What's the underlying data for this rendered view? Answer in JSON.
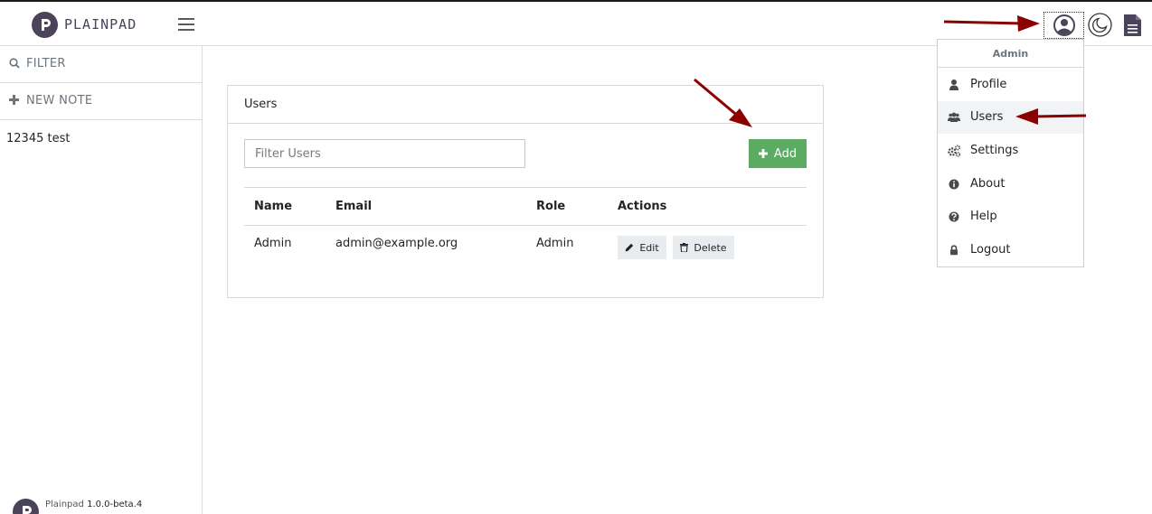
{
  "app": {
    "brand": "PLAINPAD",
    "logo_icon": "plainpad-logo-icon"
  },
  "topbar": {
    "user_icon": "user-circle-icon",
    "theme_icon": "moon-icon",
    "docs_icon": "document-icon"
  },
  "sidebar": {
    "filter_label": "FILTER",
    "new_note_label": "NEW NOTE",
    "notes": [
      "12345 test"
    ],
    "footer_name": "Plainpad",
    "footer_version": "1.0.0-beta.4"
  },
  "users_card": {
    "title": "Users",
    "filter_placeholder": "Filter Users",
    "add_label": "Add",
    "columns": [
      "Name",
      "Email",
      "Role",
      "Actions"
    ],
    "rows": [
      {
        "name": "Admin",
        "email": "admin@example.org",
        "role": "Admin"
      }
    ],
    "edit_label": "Edit",
    "delete_label": "Delete"
  },
  "user_menu": {
    "header": "Admin",
    "items": [
      {
        "label": "Profile",
        "icon": "user-icon"
      },
      {
        "label": "Users",
        "icon": "users-icon"
      },
      {
        "label": "Settings",
        "icon": "cogs-icon"
      },
      {
        "label": "About",
        "icon": "info-circle-icon"
      },
      {
        "label": "Help",
        "icon": "question-circle-icon"
      },
      {
        "label": "Logout",
        "icon": "lock-icon"
      }
    ],
    "active_item": "Users"
  },
  "colors": {
    "brand": "#4b4359",
    "add_button": "#5cab63",
    "annotation_arrow": "#8b0000"
  }
}
